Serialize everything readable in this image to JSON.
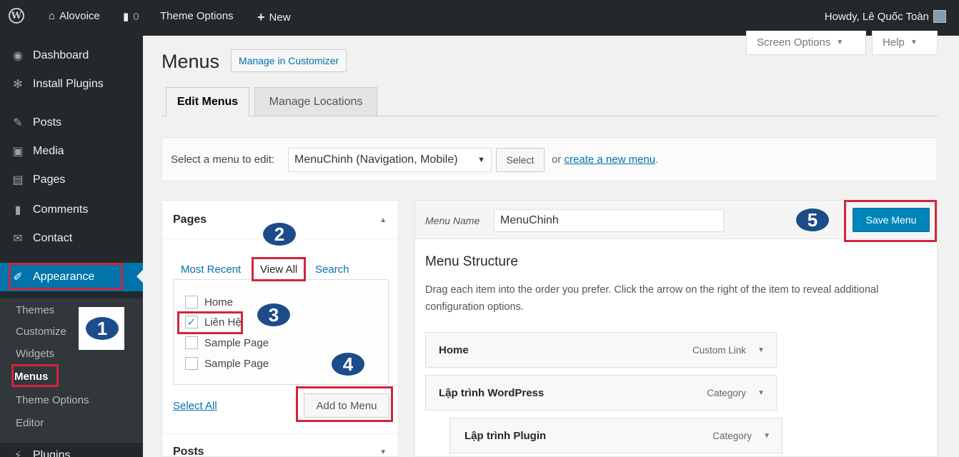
{
  "adminbar": {
    "site_name": "Alovoice",
    "comments_count": "0",
    "theme_options": "Theme Options",
    "new_label": "New",
    "howdy": "Howdy, Lê Quốc Toàn"
  },
  "sidebar": {
    "items": [
      {
        "label": "Dashboard",
        "icon": "dashboard-icon"
      },
      {
        "label": "Install Plugins",
        "icon": "gear-icon"
      },
      {
        "label": "Posts",
        "icon": "pin-icon"
      },
      {
        "label": "Media",
        "icon": "media-icon"
      },
      {
        "label": "Pages",
        "icon": "pages-icon"
      },
      {
        "label": "Comments",
        "icon": "comment-icon"
      },
      {
        "label": "Contact",
        "icon": "mail-icon"
      },
      {
        "label": "Appearance",
        "icon": "brush-icon"
      },
      {
        "label": "Plugins",
        "icon": "plug-icon"
      }
    ],
    "submenu": [
      "Themes",
      "Customize",
      "Widgets",
      "Menus",
      "Theme Options",
      "Editor"
    ]
  },
  "header": {
    "screen_options": "Screen Options",
    "help": "Help",
    "title": "Menus",
    "manage_customizer": "Manage in Customizer"
  },
  "tabs": {
    "edit": "Edit Menus",
    "locations": "Manage Locations"
  },
  "select_bar": {
    "label": "Select a menu to edit:",
    "selected": "MenuChinh (Navigation, Mobile)",
    "button": "Select",
    "or_text": "or",
    "create_link": "create a new menu",
    "period": "."
  },
  "pages_panel": {
    "title": "Pages",
    "tab_most_recent": "Most Recent",
    "tab_view_all": "View All",
    "tab_search": "Search",
    "items": [
      {
        "label": "Home",
        "checked": false
      },
      {
        "label": "Liên Hệ",
        "checked": true
      },
      {
        "label": "Sample Page",
        "checked": false
      },
      {
        "label": "Sample Page",
        "checked": false
      }
    ],
    "select_all": "Select All",
    "add_button": "Add to Menu",
    "posts_title": "Posts"
  },
  "menu_panel": {
    "name_label": "Menu Name",
    "name_value": "MenuChinh",
    "save_button": "Save Menu",
    "structure_title": "Menu Structure",
    "description": "Drag each item into the order you prefer. Click the arrow on the right of the item to reveal additional configuration options.",
    "items": [
      {
        "title": "Home",
        "type": "Custom Link"
      },
      {
        "title": "Lập trình WordPress",
        "type": "Category"
      },
      {
        "title": "Lập trình Plugin",
        "type": "Category"
      }
    ]
  },
  "annotations": [
    "1",
    "2",
    "3",
    "4",
    "5"
  ],
  "colors": {
    "admin_dark": "#23282d",
    "accent_blue": "#0073aa",
    "save_button": "#0085ba",
    "annotation_red": "#d0263a",
    "badge_blue": "#1c4c8a"
  }
}
